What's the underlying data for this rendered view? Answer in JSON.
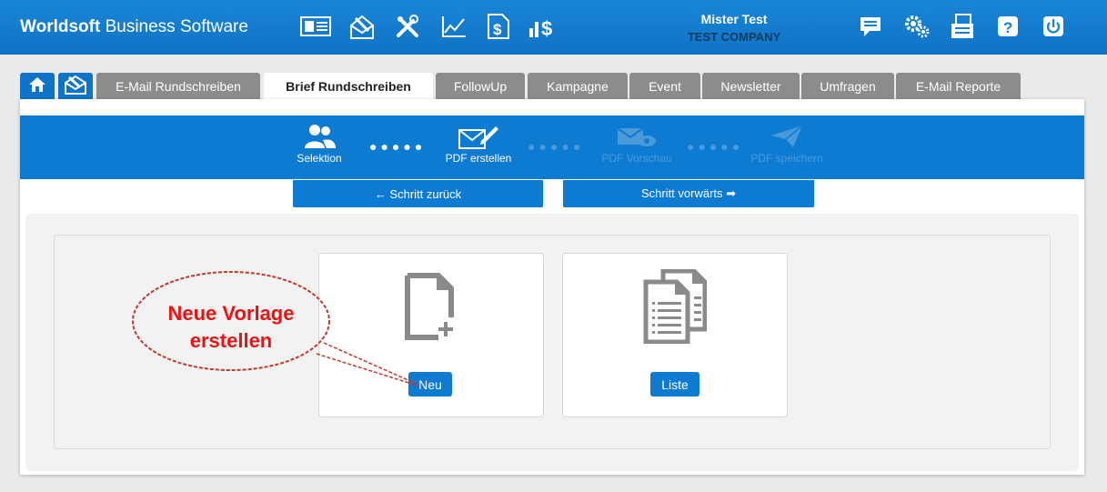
{
  "header": {
    "brand_bold": "Worldsoft",
    "brand_rest": " Business Software",
    "user_name": "Mister Test",
    "company": "TEST COMPANY",
    "nav_icons": [
      "contact-card-icon",
      "mail-campaign-icon",
      "tools-icon",
      "line-chart-icon",
      "invoice-dollar-icon",
      "bar-dollar-icon"
    ],
    "right_icons": [
      "message-icon",
      "settings-gears-icon",
      "fax-printer-icon",
      "help-icon",
      "power-icon"
    ]
  },
  "tabs": [
    {
      "label": "E-Mail Rundschreiben"
    },
    {
      "label": "Brief Rundschreiben"
    },
    {
      "label": "FollowUp"
    },
    {
      "label": "Kampagne"
    },
    {
      "label": "Event"
    },
    {
      "label": "Newsletter"
    },
    {
      "label": "Umfragen"
    },
    {
      "label": "E-Mail Reporte"
    }
  ],
  "wizard": {
    "steps": [
      {
        "label": "Selektion",
        "active": true
      },
      {
        "label": "PDF erstellen",
        "active": true
      },
      {
        "label": "PDF Vorschau",
        "active": false
      },
      {
        "label": "PDF speichern",
        "active": false
      }
    ],
    "back_label": "← Schritt zurück",
    "next_label": "Schritt vorwärts ➡"
  },
  "cards": {
    "new_label": "Neu",
    "list_label": "Liste"
  },
  "annotation": {
    "line1": "Neue Vorlage",
    "line2": "erstellen"
  },
  "colors": {
    "primary": "#0e7bd3",
    "tab_inactive": "#8c8c8c",
    "annotation": "#ee1111"
  }
}
